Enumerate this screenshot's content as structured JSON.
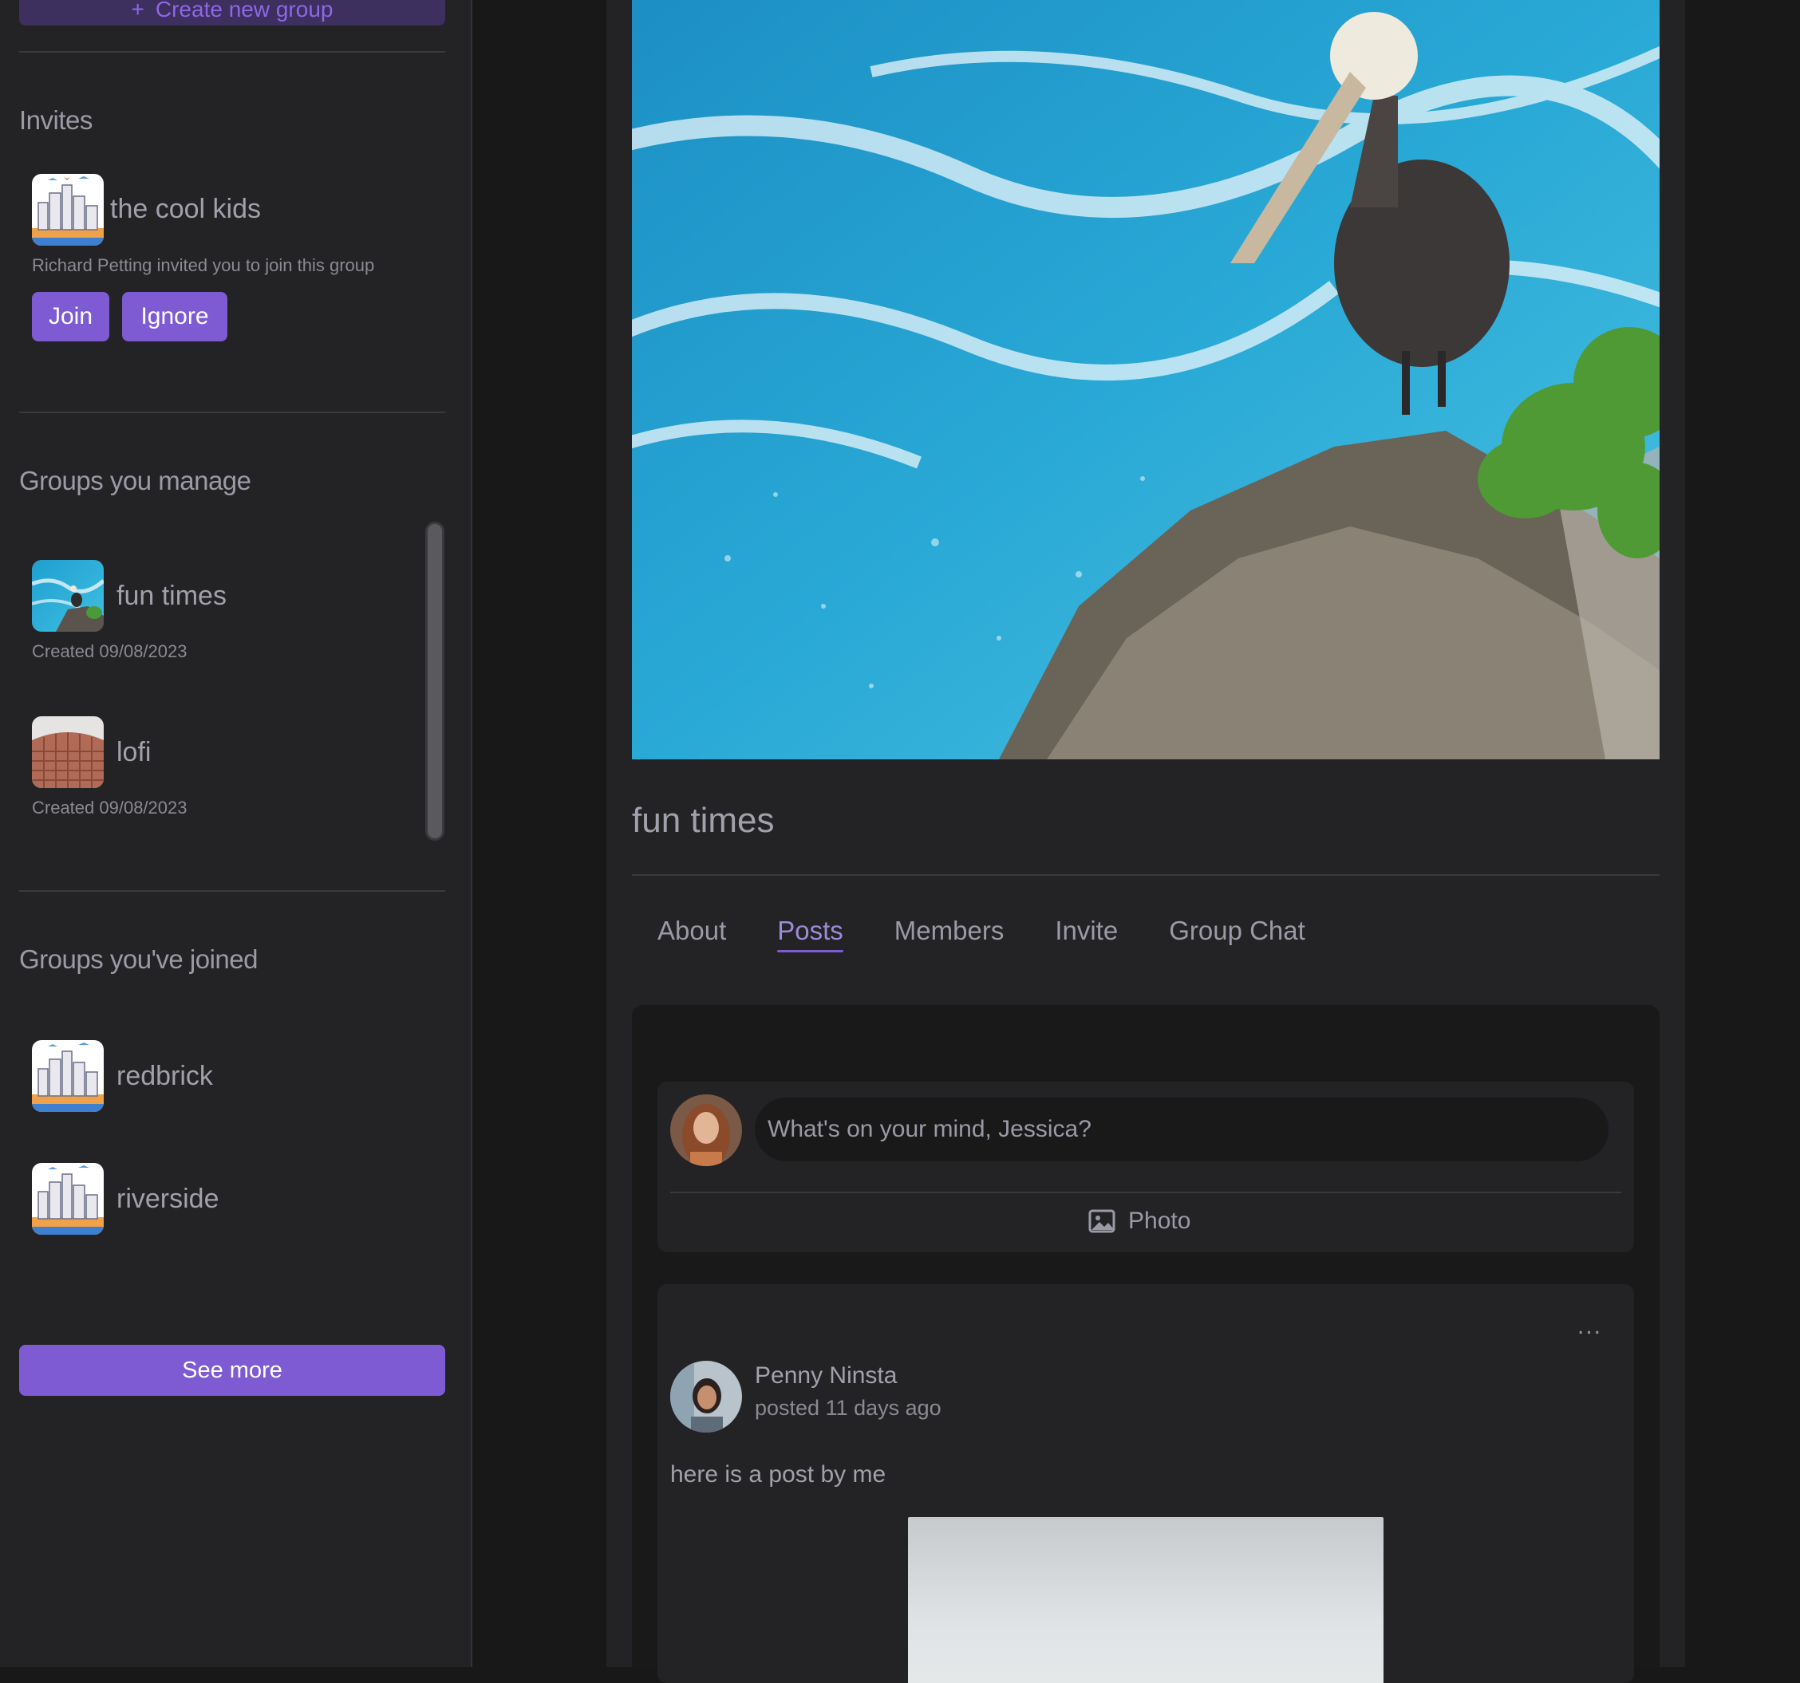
{
  "sidebar": {
    "create_button": "Create new group",
    "invites": {
      "title": "Invites",
      "group_name": "the cool kids",
      "description": "Richard Petting invited you to join this group",
      "join_label": "Join",
      "ignore_label": "Ignore"
    },
    "managed": {
      "title": "Groups you manage",
      "items": [
        {
          "name": "fun times",
          "created": "Created 09/08/2023"
        },
        {
          "name": "lofi",
          "created": "Created 09/08/2023"
        }
      ]
    },
    "joined": {
      "title": "Groups you've joined",
      "items": [
        {
          "name": "redbrick"
        },
        {
          "name": "riverside"
        }
      ]
    },
    "see_more": "See more"
  },
  "main": {
    "group_title": "fun times",
    "tabs": [
      {
        "label": "About"
      },
      {
        "label": "Posts",
        "active": true
      },
      {
        "label": "Members"
      },
      {
        "label": "Invite"
      },
      {
        "label": "Group Chat"
      }
    ],
    "composer": {
      "placeholder": "What's on your mind, Jessica?",
      "photo_label": "Photo"
    },
    "post": {
      "author": "Penny Ninsta",
      "time": "posted 11 days ago",
      "body": "here is a post by me",
      "menu": "..."
    }
  },
  "colors": {
    "accent": "#7f5bd3",
    "background": "#181818",
    "panel": "#232225"
  }
}
